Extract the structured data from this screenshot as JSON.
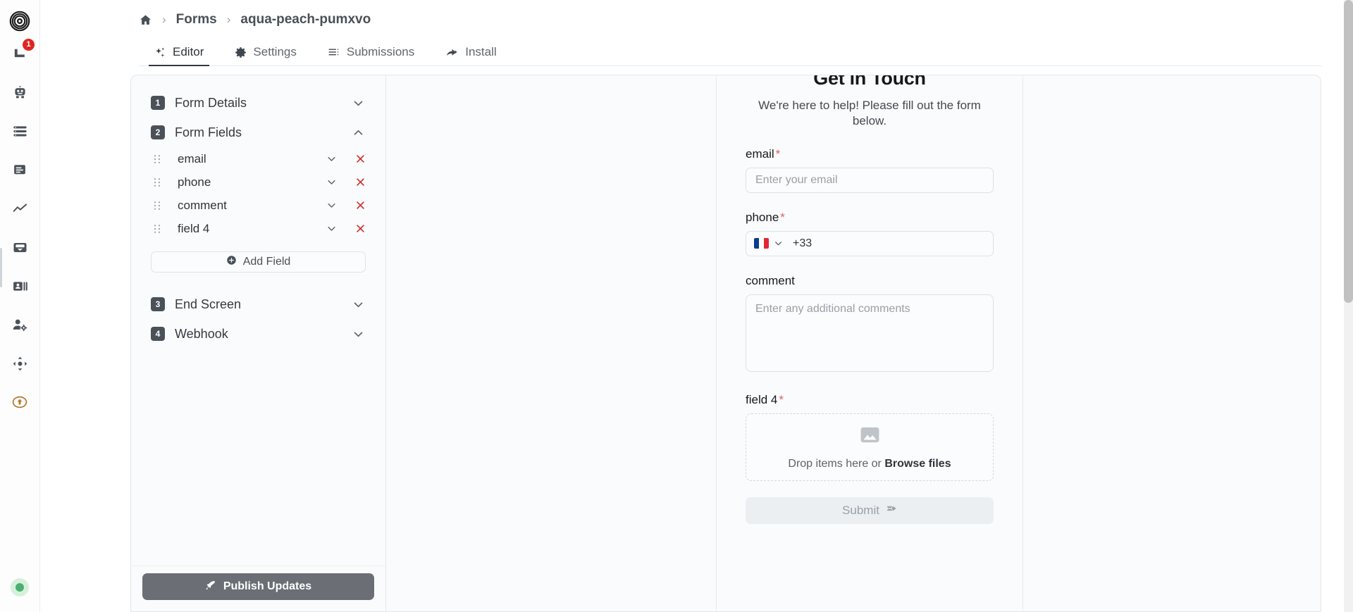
{
  "rail": {
    "items": [
      {
        "name": "app-logo",
        "icon": "spiral-logo-icon",
        "badge": null
      },
      {
        "name": "inbox",
        "icon": "inbox-folder-icon",
        "badge": "1"
      },
      {
        "name": "bot",
        "icon": "robot-icon",
        "badge": null
      },
      {
        "name": "list",
        "icon": "list-icon",
        "badge": null
      },
      {
        "name": "document",
        "icon": "document-icon",
        "badge": null
      },
      {
        "name": "analytics",
        "icon": "line-chart-icon",
        "badge": null
      },
      {
        "name": "inbox-tray",
        "icon": "tray-icon",
        "badge": null
      },
      {
        "name": "contacts",
        "icon": "contact-card-icon",
        "badge": null
      },
      {
        "name": "user-settings",
        "icon": "user-gear-icon",
        "badge": null
      },
      {
        "name": "integrations",
        "icon": "nodes-icon",
        "badge": null
      },
      {
        "name": "upload",
        "icon": "upload-circle-icon",
        "badge": null
      }
    ],
    "status": "online"
  },
  "breadcrumb": {
    "home_icon": "home-icon",
    "items": [
      "Forms",
      "aqua-peach-pumxvo"
    ],
    "separator": "›"
  },
  "tabs": [
    {
      "label": "Editor",
      "icon": "sparkles-icon",
      "active": true
    },
    {
      "label": "Settings",
      "icon": "gear-icon",
      "active": false
    },
    {
      "label": "Submissions",
      "icon": "list-lines-icon",
      "active": false
    },
    {
      "label": "Install",
      "icon": "share-arrow-icon",
      "active": false
    }
  ],
  "editor": {
    "sections": [
      {
        "num": "1",
        "title": "Form Details",
        "expanded": false
      },
      {
        "num": "2",
        "title": "Form Fields",
        "expanded": true
      },
      {
        "num": "3",
        "title": "End Screen",
        "expanded": false
      },
      {
        "num": "4",
        "title": "Webhook",
        "expanded": false
      }
    ],
    "fields": [
      {
        "label": "email"
      },
      {
        "label": "phone"
      },
      {
        "label": "comment"
      },
      {
        "label": "field 4"
      }
    ],
    "add_field_label": "Add Field",
    "publish_label": "Publish Updates",
    "publish_icon": "rocket-icon"
  },
  "preview": {
    "title": "Get in Touch",
    "subtitle": "We're here to help! Please fill out the form below.",
    "fields": {
      "email": {
        "label": "email",
        "required": true,
        "placeholder": "Enter your email",
        "value": ""
      },
      "phone": {
        "label": "phone",
        "required": true,
        "country_flag": "france-flag-icon",
        "dial_code": "+33"
      },
      "comment": {
        "label": "comment",
        "required": false,
        "placeholder": "Enter any additional comments",
        "value": ""
      },
      "field4": {
        "label": "field 4",
        "required": true,
        "dropzone_prefix": "Drop items here or ",
        "dropzone_action": "Browse files",
        "icon": "image-placeholder-icon"
      }
    },
    "submit_label": "Submit",
    "submit_icon": "send-icon"
  },
  "colors": {
    "accent_red": "#d03030",
    "required_red": "#e06060",
    "publish_bg": "#6b6f75",
    "badge_red": "#e02424",
    "step_bg": "#4a5159"
  }
}
